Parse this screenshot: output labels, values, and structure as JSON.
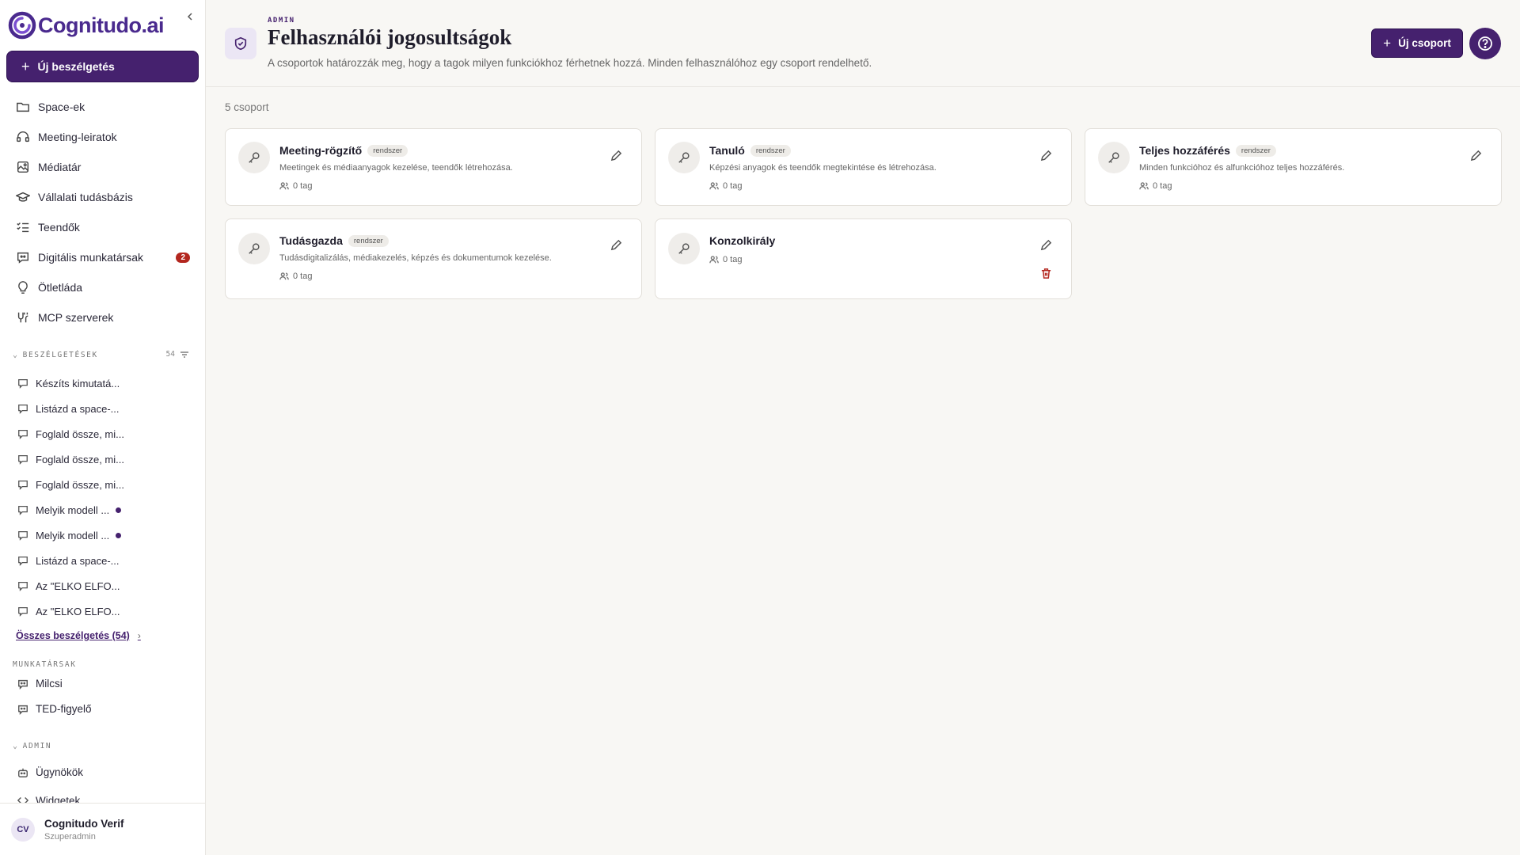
{
  "brand": {
    "name": "Cognitudo.ai",
    "color": "#4a2a8e"
  },
  "sidebar": {
    "new_chat_label": "Új beszélgetés",
    "nav": [
      {
        "label": "Space-ek",
        "icon": "folder-icon"
      },
      {
        "label": "Meeting-leiratok",
        "icon": "headset-icon"
      },
      {
        "label": "Médiatár",
        "icon": "media-icon"
      },
      {
        "label": "Vállalati tudásbázis",
        "icon": "graduation-cap-icon"
      },
      {
        "label": "Teendők",
        "icon": "checklist-icon"
      },
      {
        "label": "Digitális munkatársak",
        "icon": "bot-chat-icon",
        "badge": "2"
      },
      {
        "label": "Ötletláda",
        "icon": "lightbulb-icon"
      },
      {
        "label": "MCP szerverek",
        "icon": "plug-icon"
      }
    ],
    "conversations_heading": "BESZÉLGETÉSEK",
    "conversations_count": "54",
    "conversations": [
      {
        "title": "Készíts kimutatá...",
        "unread": false
      },
      {
        "title": "Listázd a space-...",
        "unread": false
      },
      {
        "title": "Foglald össze, mi...",
        "unread": false
      },
      {
        "title": "Foglald össze, mi...",
        "unread": false
      },
      {
        "title": "Foglald össze, mi...",
        "unread": false
      },
      {
        "title": "Melyik modell ...",
        "unread": true
      },
      {
        "title": "Melyik modell ...",
        "unread": true
      },
      {
        "title": "Listázd a space-...",
        "unread": false
      },
      {
        "title": "Az \"ELKO ELFO...",
        "unread": false
      },
      {
        "title": "Az \"ELKO ELFO...",
        "unread": false
      }
    ],
    "all_conversations_label": "Összes beszélgetés (54)",
    "coworkers_heading": "MUNKATÁRSAK",
    "coworkers": [
      "Milcsi",
      "TED-figyelő"
    ],
    "admin_heading": "ADMIN",
    "admin_items": [
      "Ügynökök",
      "Widgetek"
    ],
    "user": {
      "initials": "CV",
      "name": "Cognitudo Verif",
      "role": "Szuperadmin"
    }
  },
  "header": {
    "kicker": "ADMIN",
    "title": "Felhasználói jogosultságok",
    "subtitle": "A csoportok határozzák meg, hogy a tagok milyen funkciókhoz férhetnek hozzá. Minden felhasználóhoz egy csoport rendelhető.",
    "new_group_label": "Új csoport"
  },
  "groups_count_label": "5 csoport",
  "groups": [
    {
      "name": "Meeting-rögzítő",
      "tag": "rendszer",
      "description": "Meetingek és médiaanyagok kezelése, teendők létrehozása.",
      "members": "0 tag"
    },
    {
      "name": "Tanuló",
      "tag": "rendszer",
      "description": "Képzési anyagok és teendők megtekintése és létrehozása.",
      "members": "0 tag"
    },
    {
      "name": "Teljes hozzáférés",
      "tag": "rendszer",
      "description": "Minden funkcióhoz és alfunkcióhoz teljes hozzáférés.",
      "members": "0 tag"
    },
    {
      "name": "Tudásgazda",
      "tag": "rendszer",
      "description": "Tudásdigitalizálás, médiakezelés, képzés és dokumentumok kezelése.",
      "members": "0 tag"
    },
    {
      "name": "Konzolkirály",
      "tag": "",
      "description": "",
      "members": "0 tag"
    }
  ],
  "colors": {
    "accent": "#45216e",
    "danger": "#b3261e",
    "background": "#f8f7f4"
  }
}
